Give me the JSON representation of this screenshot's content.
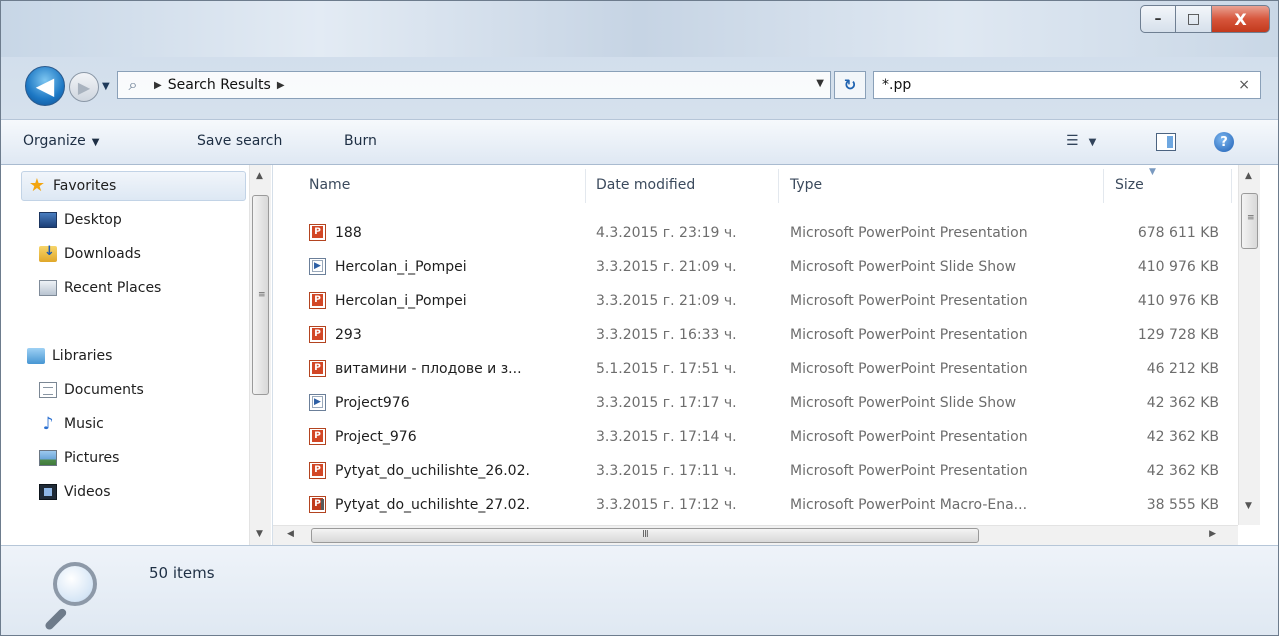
{
  "window": {
    "controls": {
      "minimize": "–",
      "maximize": "□",
      "close": "X"
    }
  },
  "nav": {
    "back_glyph": "◀",
    "forward_glyph": "▶",
    "history_caret": "▼",
    "address": {
      "crumb": "Search Results",
      "arrow": "▶",
      "dropdown": "▼"
    },
    "refresh_glyph": "↻",
    "search": {
      "value": "*.pp",
      "clear": "×"
    }
  },
  "toolbar": {
    "organize": "Organize",
    "save_search": "Save search",
    "burn": "Burn",
    "caret": "▼"
  },
  "sidebar": {
    "favorites": "Favorites",
    "favorites_items": [
      "Desktop",
      "Downloads",
      "Recent Places"
    ],
    "libraries": "Libraries",
    "libraries_items": [
      "Documents",
      "Music",
      "Pictures",
      "Videos"
    ]
  },
  "columns": {
    "name": "Name",
    "date": "Date modified",
    "type": "Type",
    "size": "Size"
  },
  "files": [
    {
      "name": "188",
      "date": "4.3.2015 г. 23:19 ч.",
      "type": "Microsoft PowerPoint Presentation",
      "size": "678 611 KB",
      "icon": "pptx-icon"
    },
    {
      "name": "Hercolan_i_Pompei",
      "date": "3.3.2015 г. 21:09 ч.",
      "type": "Microsoft PowerPoint Slide Show",
      "size": "410 976 KB",
      "icon": "ppsx-icon"
    },
    {
      "name": "Hercolan_i_Pompei",
      "date": "3.3.2015 г. 21:09 ч.",
      "type": "Microsoft PowerPoint Presentation",
      "size": "410 976 KB",
      "icon": "pptx-icon"
    },
    {
      "name": "293",
      "date": "3.3.2015 г. 16:33 ч.",
      "type": "Microsoft PowerPoint Presentation",
      "size": "129 728 KB",
      "icon": "pptx-icon"
    },
    {
      "name": "витамини - плодове и з...",
      "date": "5.1.2015 г. 17:51 ч.",
      "type": "Microsoft PowerPoint Presentation",
      "size": "46 212 KB",
      "icon": "pptx-icon"
    },
    {
      "name": "Project976",
      "date": "3.3.2015 г. 17:17 ч.",
      "type": "Microsoft PowerPoint Slide Show",
      "size": "42 362 KB",
      "icon": "ppsx-icon"
    },
    {
      "name": "Project_976",
      "date": "3.3.2015 г. 17:14 ч.",
      "type": "Microsoft PowerPoint Presentation",
      "size": "42 362 KB",
      "icon": "pptx-icon"
    },
    {
      "name": "Pytyat_do_uchilishte_26.02.",
      "date": "3.3.2015 г. 17:11 ч.",
      "type": "Microsoft PowerPoint Presentation",
      "size": "42 362 KB",
      "icon": "pptx-icon"
    },
    {
      "name": "Pytyat_do_uchilishte_27.02.",
      "date": "3.3.2015 г. 17:12 ч.",
      "type": "Microsoft PowerPoint Macro-Ena...",
      "size": "38 555 KB",
      "icon": "pptm-icon"
    }
  ],
  "status": {
    "count": "50 items"
  },
  "scroll": {
    "up": "▲",
    "down": "▼",
    "left": "◀",
    "right": "▶",
    "grip_v": "≡",
    "grip_h": "III"
  }
}
